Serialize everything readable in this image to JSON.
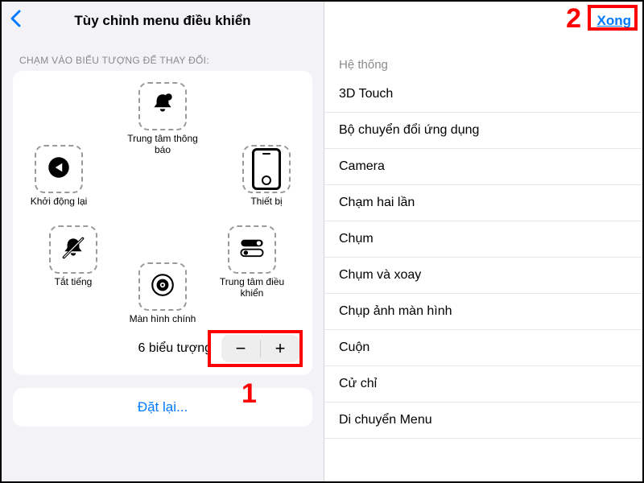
{
  "left": {
    "title": "Tùy chỉnh menu điều khiển",
    "section_hint": "CHẠM VÀO BIỂU TƯỢNG ĐỂ THAY ĐỔI:",
    "slots": {
      "top": "Trung tâm thông báo",
      "tl": "Khởi động lại",
      "tr": "Thiết bị",
      "bl": "Tắt tiếng",
      "br": "Trung tâm điều khiển",
      "bottom": "Màn hình chính"
    },
    "count_label": "6 biểu tượng",
    "reset": "Đặt lại..."
  },
  "right": {
    "done": "Xong",
    "group_header": "Hệ thống",
    "items": [
      "3D Touch",
      "Bộ chuyển đổi ứng dụng",
      "Camera",
      "Chạm hai lần",
      "Chụm",
      "Chụm và xoay",
      "Chụp ảnh màn hình",
      "Cuộn",
      "Cử chỉ",
      "Di chuyển Menu"
    ]
  },
  "annotations": {
    "one": "1",
    "two": "2"
  }
}
